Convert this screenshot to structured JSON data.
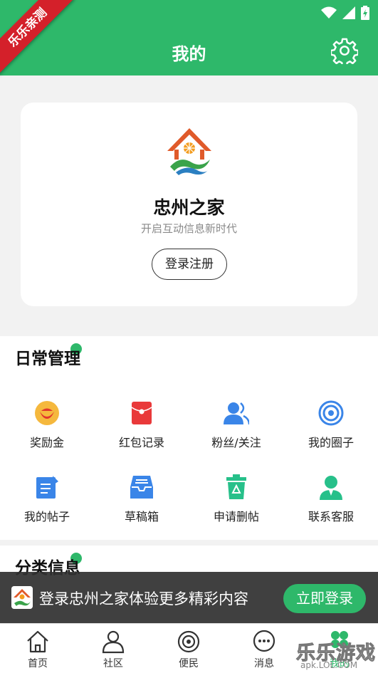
{
  "header": {
    "title": "我的"
  },
  "ribbon": {
    "text": "乐乐亲测"
  },
  "profile": {
    "app_name": "忠州之家",
    "slogan": "开启互动信息新时代",
    "login_label": "登录注册"
  },
  "daily": {
    "title": "日常管理",
    "items": [
      {
        "label": "奖励金",
        "icon": "reward-icon"
      },
      {
        "label": "红包记录",
        "icon": "red-envelope-icon"
      },
      {
        "label": "粉丝/关注",
        "icon": "fans-icon"
      },
      {
        "label": "我的圈子",
        "icon": "circle-icon"
      },
      {
        "label": "我的帖子",
        "icon": "post-icon"
      },
      {
        "label": "草稿箱",
        "icon": "draft-box-icon"
      },
      {
        "label": "申请删帖",
        "icon": "delete-post-icon"
      },
      {
        "label": "联系客服",
        "icon": "customer-service-icon"
      }
    ]
  },
  "category": {
    "title": "分类信息"
  },
  "banner": {
    "text": "登录忠州之家体验更多精彩内容",
    "button": "立即登录"
  },
  "tabs": [
    {
      "label": "首页",
      "icon": "home-icon"
    },
    {
      "label": "社区",
      "icon": "community-icon"
    },
    {
      "label": "便民",
      "icon": "convenience-icon"
    },
    {
      "label": "消息",
      "icon": "message-icon"
    },
    {
      "label": "我的",
      "icon": "profile-icon",
      "active": true
    }
  ],
  "watermark": {
    "text": "乐乐游戏",
    "url": "apk.LOL.COM"
  },
  "colors": {
    "primary": "#2eb86a",
    "ribbon": "#d4202a",
    "banner_bg": "#303030"
  }
}
